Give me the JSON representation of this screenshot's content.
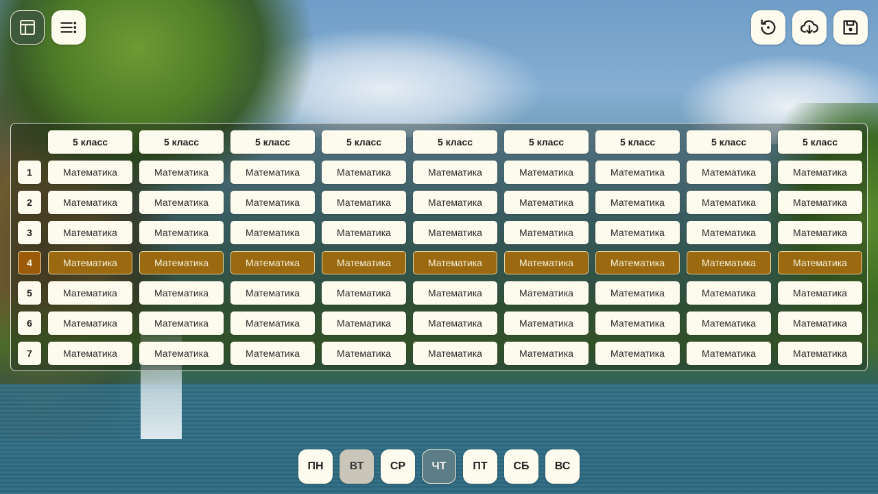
{
  "toolbar_left": [
    {
      "name": "layout-icon",
      "active": true
    },
    {
      "name": "list-icon",
      "active": false
    }
  ],
  "toolbar_right": [
    {
      "name": "reset-icon"
    },
    {
      "name": "cloud-download-icon"
    },
    {
      "name": "save-icon"
    }
  ],
  "schedule": {
    "class_headers": [
      "5 класс",
      "5 класс",
      "5 класс",
      "5 класс",
      "5 класс",
      "5 класс",
      "5 класс",
      "5 класс",
      "5 класс"
    ],
    "highlighted_row": 4,
    "rows": [
      {
        "num": "1",
        "lessons": [
          "Математика",
          "Математика",
          "Математика",
          "Математика",
          "Математика",
          "Математика",
          "Математика",
          "Математика",
          "Математика"
        ]
      },
      {
        "num": "2",
        "lessons": [
          "Математика",
          "Математика",
          "Математика",
          "Математика",
          "Математика",
          "Математика",
          "Математика",
          "Математика",
          "Математика"
        ]
      },
      {
        "num": "3",
        "lessons": [
          "Математика",
          "Математика",
          "Математика",
          "Математика",
          "Математика",
          "Математика",
          "Математика",
          "Математика",
          "Математика"
        ]
      },
      {
        "num": "4",
        "lessons": [
          "Математика",
          "Математика",
          "Математика",
          "Математика",
          "Математика",
          "Математика",
          "Математика",
          "Математика",
          "Математика"
        ]
      },
      {
        "num": "5",
        "lessons": [
          "Математика",
          "Математика",
          "Математика",
          "Математика",
          "Математика",
          "Математика",
          "Математика",
          "Математика",
          "Математика"
        ]
      },
      {
        "num": "6",
        "lessons": [
          "Математика",
          "Математика",
          "Математика",
          "Математика",
          "Математика",
          "Математика",
          "Математика",
          "Математика",
          "Математика"
        ]
      },
      {
        "num": "7",
        "lessons": [
          "Математика",
          "Математика",
          "Математика",
          "Математика",
          "Математика",
          "Математика",
          "Математика",
          "Математика",
          "Математика"
        ]
      }
    ]
  },
  "days": [
    {
      "label": "ПН",
      "state": "normal"
    },
    {
      "label": "ВТ",
      "state": "muted"
    },
    {
      "label": "СР",
      "state": "normal"
    },
    {
      "label": "ЧТ",
      "state": "active"
    },
    {
      "label": "ПТ",
      "state": "normal"
    },
    {
      "label": "СБ",
      "state": "normal"
    },
    {
      "label": "ВС",
      "state": "normal"
    }
  ],
  "colors": {
    "cell_bg": "#fdfbed",
    "highlight": "#9b6a10",
    "active_day": "#5c7c86",
    "active_tool": "#3f5a3b"
  }
}
